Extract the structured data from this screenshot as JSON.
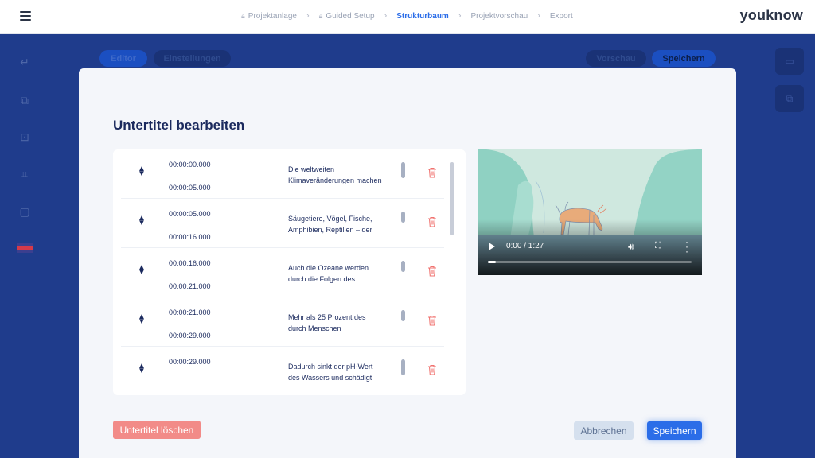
{
  "header": {
    "brand": "youknow",
    "steps": [
      {
        "label": "Projektanlage",
        "locked": true
      },
      {
        "label": "Guided Setup",
        "locked": true
      },
      {
        "label": "Strukturbaum",
        "locked": false,
        "active": true
      },
      {
        "label": "Projektvorschau",
        "locked": false
      },
      {
        "label": "Export",
        "locked": false
      }
    ]
  },
  "background": {
    "editor_label": "Editor",
    "settings_label": "Einstellungen",
    "preview_label": "Vorschau",
    "save_label": "Speichern"
  },
  "modal": {
    "title": "Untertitel bearbeiten",
    "subtitles": [
      {
        "start": "00:00:00.000",
        "end": "00:00:05.000",
        "text": "Die weltweiten Klimaveränderungen machen"
      },
      {
        "start": "00:00:05.000",
        "end": "00:00:16.000",
        "text": "Säugetiere, Vögel, Fische, Amphibien, Reptilien – der"
      },
      {
        "start": "00:00:16.000",
        "end": "00:00:21.000",
        "text": "Auch die Ozeane werden durch die Folgen des"
      },
      {
        "start": "00:00:21.000",
        "end": "00:00:29.000",
        "text": "Mehr als 25 Prozent des durch Menschen"
      },
      {
        "start": "00:00:29.000",
        "end": "",
        "text": "Dadurch sinkt der pH-Wert des Wassers und schädigt"
      }
    ],
    "video": {
      "time": "0:00 / 1:27",
      "progress": 0.04
    },
    "delete_label": "Untertitel löschen",
    "cancel_label": "Abbrechen",
    "save_label": "Speichern"
  },
  "colors": {
    "primary": "#2b6de8",
    "danger": "#f28b88",
    "overlay": "#1f3c8c"
  }
}
